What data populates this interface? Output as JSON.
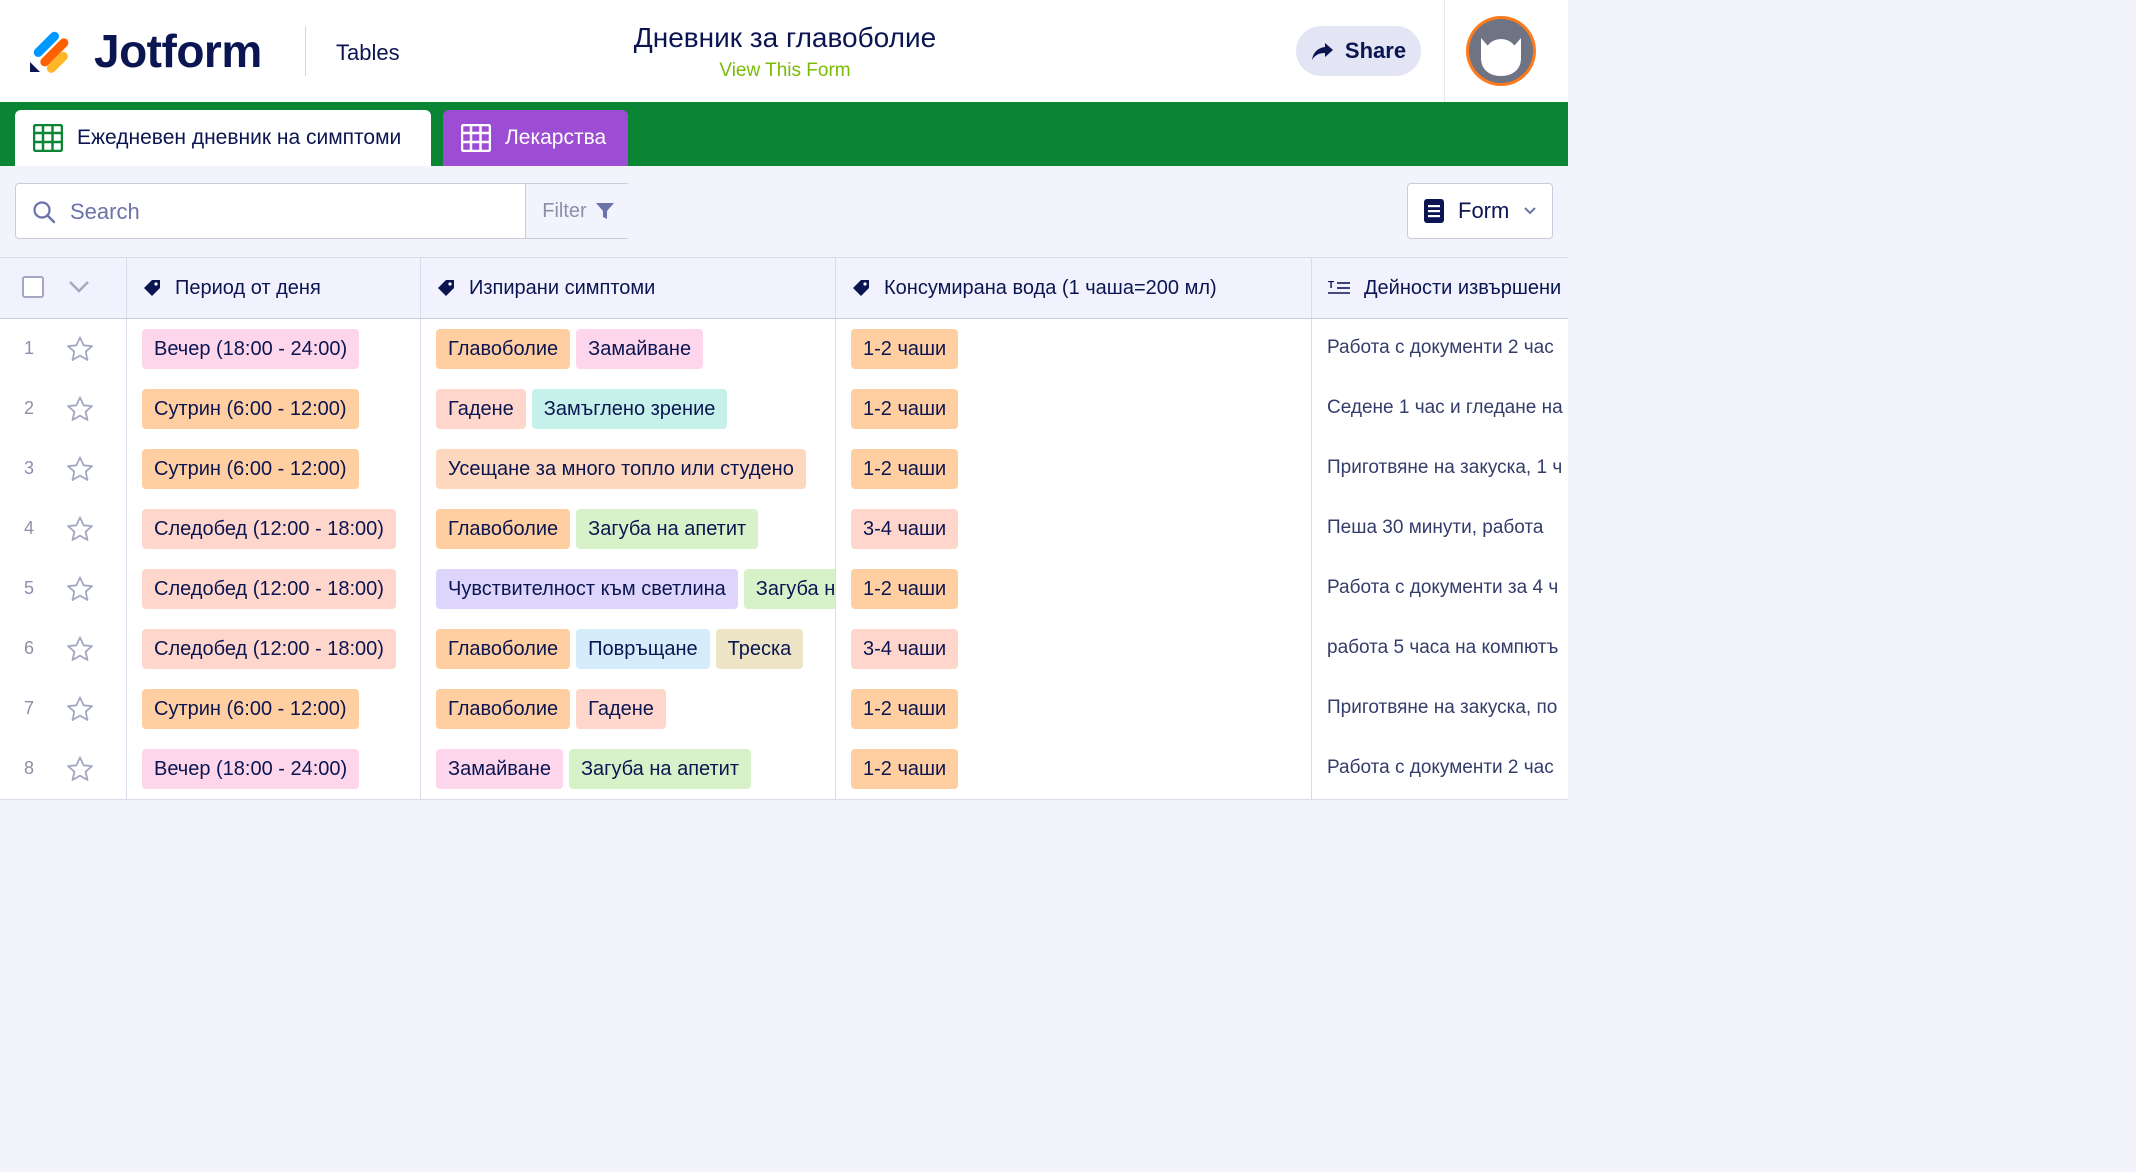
{
  "header": {
    "brand": "Jotform",
    "section": "Tables",
    "form_title": "Дневник за главоболие",
    "view_form": "View This Form",
    "share_label": "Share"
  },
  "tabs": [
    {
      "label": "Ежедневен дневник на симптоми",
      "color": "#0a8534",
      "active": true
    },
    {
      "label": "Лекарства",
      "color": "#9c4dd3",
      "active": false
    }
  ],
  "toolbar": {
    "search_placeholder": "Search",
    "filter_label": "Filter",
    "form_label": "Form"
  },
  "table": {
    "columns": [
      {
        "label": "Период от деня",
        "icon": "tag-icon"
      },
      {
        "label": "Изпирани симптоми",
        "icon": "tag-icon"
      },
      {
        "label": "Консумирана вода (1 чаша=200 мл)",
        "icon": "tag-icon"
      },
      {
        "label": "Дейности извършени",
        "icon": "text-icon"
      }
    ],
    "rows": [
      {
        "num": "1",
        "period": "Вечер (18:00 - 24:00)",
        "symptoms": [
          "Главоболие",
          "Замайване"
        ],
        "water": "1-2 чаши",
        "activities": "Работа с документи 2 час"
      },
      {
        "num": "2",
        "period": "Сутрин (6:00 - 12:00)",
        "symptoms": [
          "Гадене",
          "Замъглено зрение"
        ],
        "water": "1-2 чаши",
        "activities": "Седене 1 час и гледане на"
      },
      {
        "num": "3",
        "period": "Сутрин (6:00 - 12:00)",
        "symptoms": [
          "Усещане за много топло или студено"
        ],
        "water": "1-2 чаши",
        "activities": "Приготвяне на закуска, 1 ч"
      },
      {
        "num": "4",
        "period": "Следобед (12:00 - 18:00)",
        "symptoms": [
          "Главоболие",
          "Загуба на апетит"
        ],
        "water": "3-4 чаши",
        "activities": "Пеша 30 минути, работа"
      },
      {
        "num": "5",
        "period": "Следобед (12:00 - 18:00)",
        "symptoms": [
          "Чувствителност към светлина",
          "Загуба на апетит"
        ],
        "water": "1-2 чаши",
        "activities": "Работа с документи за 4 ч"
      },
      {
        "num": "6",
        "period": "Следобед (12:00 - 18:00)",
        "symptoms": [
          "Главоболие",
          "Повръщане",
          "Треска"
        ],
        "water": "3-4 чаши",
        "activities": "работа 5 часа на компютъ"
      },
      {
        "num": "7",
        "period": "Сутрин (6:00 - 12:00)",
        "symptoms": [
          "Главоболие",
          "Гадене"
        ],
        "water": "1-2 чаши",
        "activities": "Приготвяне на закуска, по"
      },
      {
        "num": "8",
        "period": "Вечер (18:00 - 24:00)",
        "symptoms": [
          "Замайване",
          "Загуба на апетит"
        ],
        "water": "1-2 чаши",
        "activities": "Работа с документи 2 час"
      }
    ]
  },
  "colors": {
    "tabbar": "#0a8534",
    "accent_green": "#78bb07",
    "avatar_orange": "#ff7a1a"
  }
}
